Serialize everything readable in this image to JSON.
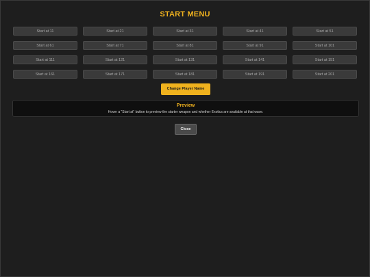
{
  "menu": {
    "title": "START MENU",
    "start_buttons": [
      "Start at 11",
      "Start at 21",
      "Start at 31",
      "Start at 41",
      "Start at 51",
      "Start at 61",
      "Start at 71",
      "Start at 81",
      "Start at 91",
      "Start at 101",
      "Start at 111",
      "Start at 121",
      "Start at 131",
      "Start at 141",
      "Start at 151",
      "Start at 161",
      "Start at 171",
      "Start at 181",
      "Start at 191",
      "Start at 201"
    ],
    "change_name_label": "Change Player Name",
    "preview": {
      "title": "Preview",
      "text": "Hover a \"Start at\" button to preview the starter weapon and whether Exotics are available at that wave."
    },
    "close_label": "Close"
  },
  "colors": {
    "accent": "#f0b21e",
    "background": "#1e1e1e",
    "button": "#3a3a3a"
  }
}
